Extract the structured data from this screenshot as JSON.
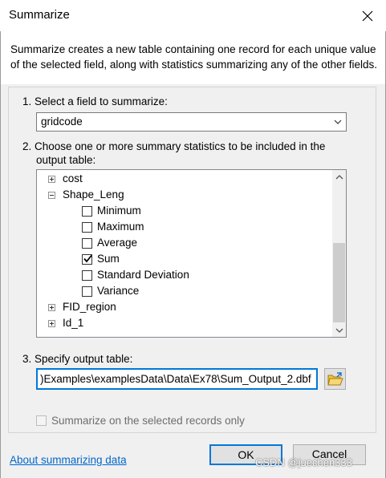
{
  "window": {
    "title": "Summarize"
  },
  "description": "Summarize creates a new table containing one record for each unique value of the selected field, along with statistics summarizing any of the other fields.",
  "step1": {
    "label": "1.  Select a field to summarize:",
    "selected_field": "gridcode"
  },
  "step2": {
    "label_line1": "2.  Choose one or more summary statistics to be included in the",
    "label_line2": "output table:",
    "tree": [
      {
        "type": "field",
        "label": "cost",
        "expanded": false
      },
      {
        "type": "field",
        "label": "Shape_Leng",
        "expanded": true
      },
      {
        "type": "stat",
        "label": "Minimum",
        "checked": false
      },
      {
        "type": "stat",
        "label": "Maximum",
        "checked": false
      },
      {
        "type": "stat",
        "label": "Average",
        "checked": false
      },
      {
        "type": "stat",
        "label": "Sum",
        "checked": true
      },
      {
        "type": "stat",
        "label": "Standard Deviation",
        "checked": false
      },
      {
        "type": "stat",
        "label": "Variance",
        "checked": false
      },
      {
        "type": "field",
        "label": "FID_region",
        "expanded": false
      },
      {
        "type": "field",
        "label": "Id_1",
        "expanded": false
      }
    ]
  },
  "step3": {
    "label": "3.  Specify output table:",
    "output_path": ")Examples\\examplesData\\Data\\Ex78\\Sum_Output_2.dbf"
  },
  "selected_records_label": "Summarize on the selected records only",
  "help_link": "About summarizing data",
  "buttons": {
    "ok": "OK",
    "cancel": "Cancel"
  },
  "watermark": "CSDN @juechen333"
}
